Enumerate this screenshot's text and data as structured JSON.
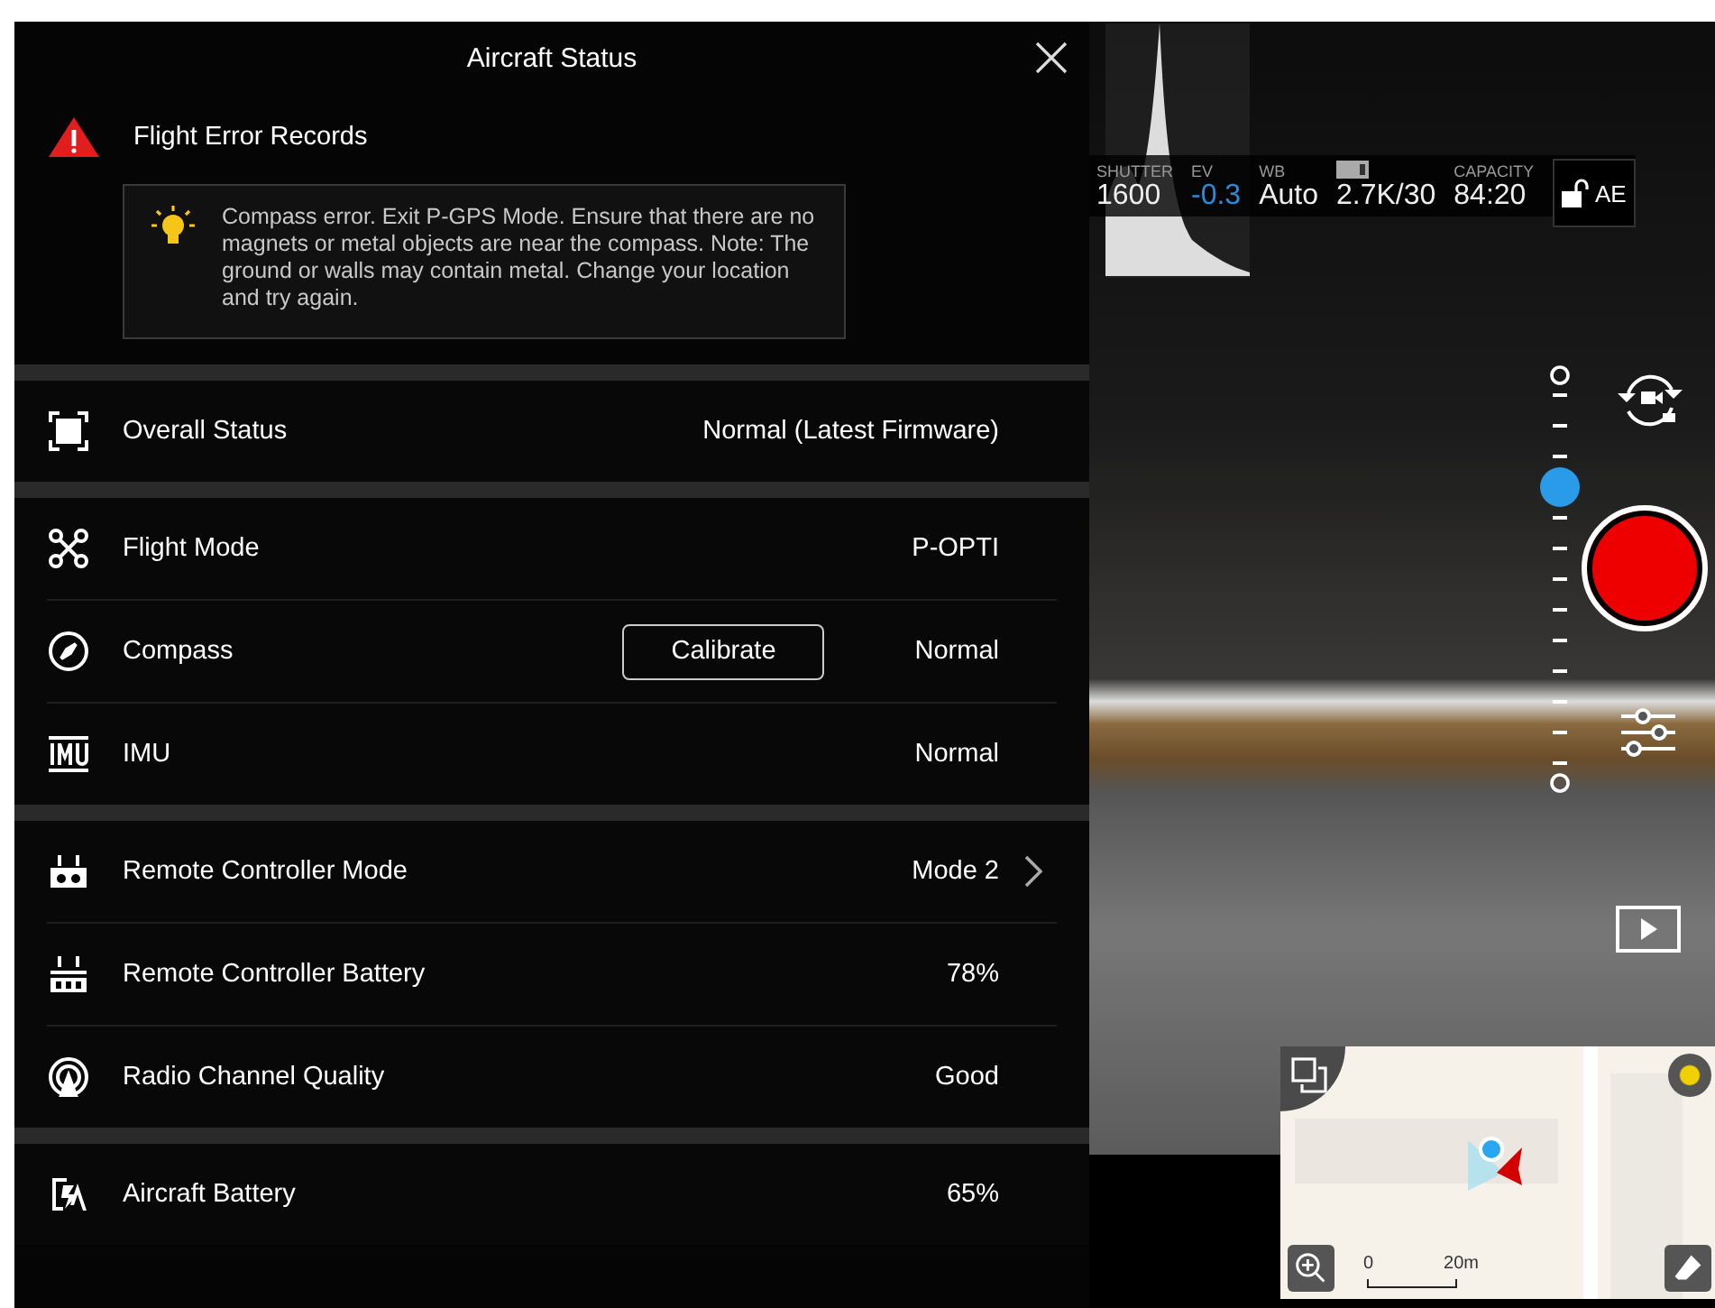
{
  "panel": {
    "title": "Aircraft Status",
    "error": {
      "title": "Flight Error Records",
      "message": "Compass error. Exit P-GPS Mode. Ensure that there are no magnets or metal objects are near the compass. Note: The ground or walls may contain metal. Change your location and try again."
    },
    "sections": [
      {
        "rows": [
          {
            "label": "Overall Status",
            "value": "Normal (Latest Firmware)",
            "chevron": false
          }
        ]
      },
      {
        "rows": [
          {
            "label": "Flight Mode",
            "value": "P-OPTI",
            "chevron": false
          },
          {
            "label": "Compass",
            "value": "Normal",
            "button": "Calibrate",
            "chevron": false
          },
          {
            "label": "IMU",
            "value": "Normal",
            "chevron": false
          }
        ]
      },
      {
        "rows": [
          {
            "label": "Remote Controller Mode",
            "value": "Mode 2",
            "chevron": true
          },
          {
            "label": "Remote Controller Battery",
            "value": "78%",
            "chevron": false
          },
          {
            "label": "Radio Channel Quality",
            "value": "Good",
            "chevron": false
          }
        ]
      },
      {
        "rows": [
          {
            "label": "Aircraft Battery",
            "value": "65%",
            "chevron": false
          }
        ]
      }
    ]
  },
  "camera_settings": [
    {
      "label": "SHUTTER",
      "value": "1600",
      "highlighted": false
    },
    {
      "label": "EV",
      "value": "-0.3",
      "highlighted": true
    },
    {
      "label": "WB",
      "value": "Auto",
      "highlighted": false
    },
    {
      "value": "2.7K/30",
      "highlighted": false
    },
    {
      "label": "CAPACITY",
      "value": "84:20",
      "highlighted": false
    }
  ],
  "ae_lock": {
    "label": "AE"
  },
  "zoom_slider": {
    "level": 0.75
  },
  "map": {
    "scale_start": "0",
    "scale_end": "20m"
  }
}
